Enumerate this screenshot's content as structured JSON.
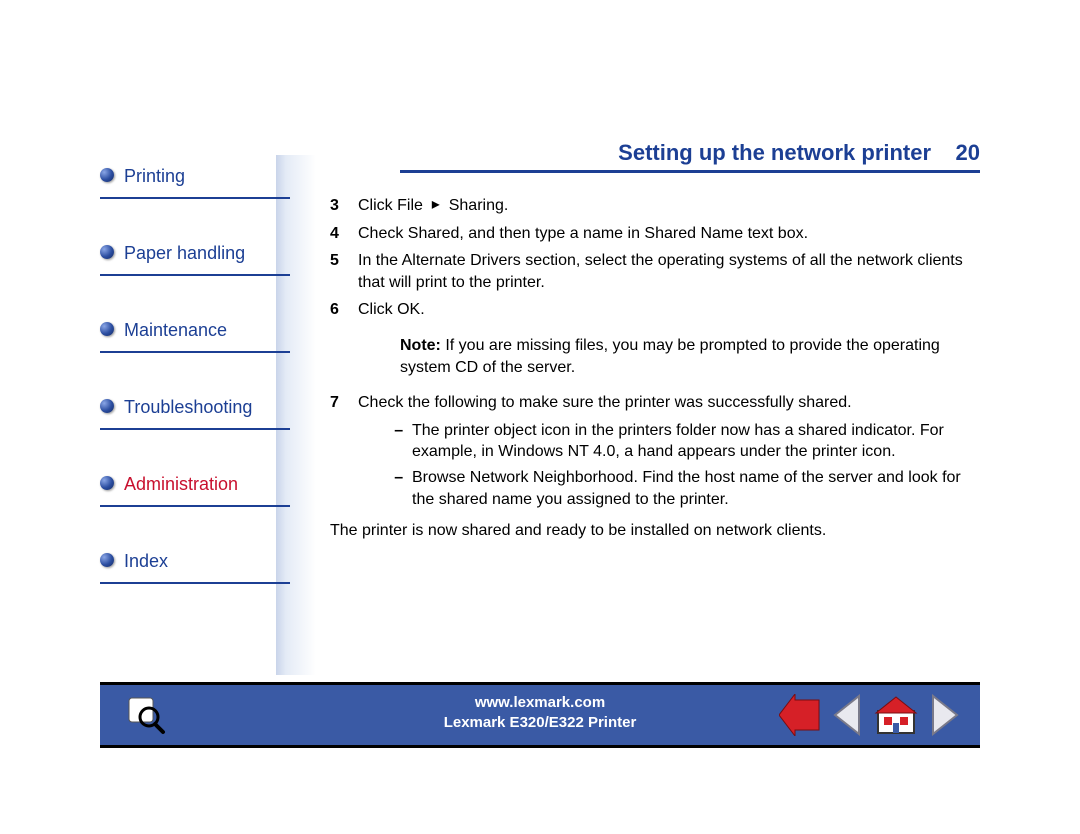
{
  "header": {
    "title": "Setting up the network printer",
    "page_number": "20"
  },
  "sidebar": {
    "items": [
      {
        "label": "Printing",
        "active": false
      },
      {
        "label": "Paper handling",
        "active": false
      },
      {
        "label": "Maintenance",
        "active": false
      },
      {
        "label": "Troubleshooting",
        "active": false
      },
      {
        "label": "Administration",
        "active": true
      },
      {
        "label": "Index",
        "active": false
      }
    ]
  },
  "steps": {
    "s3_pre": "Click File",
    "s3_post": "Sharing.",
    "s4": "Check Shared, and then type a name in Shared Name text box.",
    "s5": "In the Alternate Drivers section, select the operating systems of all the network clients that will print to the printer.",
    "s6": "Click OK.",
    "note_label": "Note:",
    "note_text": " If you are missing files, you may be prompted to provide the operating system CD of the server.",
    "s7": "Check the following to make sure the printer was successfully shared.",
    "s7a": "The printer object icon in the printers folder now has a shared indicator. For example, in Windows NT 4.0, a hand appears under the printer icon.",
    "s7b": "Browse Network Neighborhood. Find the host name of the server and look for the shared name you assigned to the printer.",
    "final": "The printer is now shared and ready to be installed on network clients."
  },
  "footer": {
    "url": "www.lexmark.com",
    "model": "Lexmark E320/E322 Printer"
  },
  "icons": {
    "search": "search-icon",
    "back": "arrow-left-icon",
    "prev_alt": "triangle-left-icon",
    "home": "home-icon",
    "next": "triangle-right-icon"
  }
}
